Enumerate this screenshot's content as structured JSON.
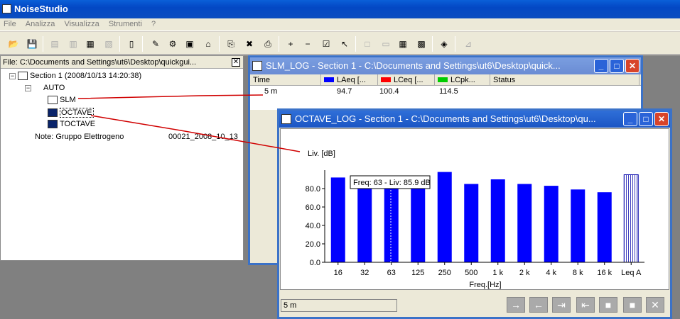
{
  "app": {
    "title": "NoiseStudio"
  },
  "menu": [
    "File",
    "Analizza",
    "Visualizza",
    "Strumenti",
    "?"
  ],
  "file_panel": {
    "title": "File: C:\\Documents and Settings\\ut6\\Desktop\\quickgui...",
    "section": "Section 1   (2008/10/13 14:20:38)",
    "auto": "AUTO",
    "slm": "SLM",
    "octave": "OCTAVE",
    "toctave": "TOCTAVE",
    "note": "Note: Gruppo Elettrogeno",
    "note_id": "00021_2008_10_13"
  },
  "slm_window": {
    "title": "SLM_LOG - Section 1 - C:\\Documents and Settings\\ut6\\Desktop\\quick...",
    "columns": [
      "Time",
      "LAeq [...",
      "LCeq [...",
      "LCpk...",
      "Status"
    ],
    "swatch_colors": [
      "#0000ff",
      "#ff0000",
      "#00cc00"
    ],
    "row": [
      "5 m",
      "94.7",
      "100.4",
      "114.5",
      ""
    ]
  },
  "octave_window": {
    "title": "OCTAVE_LOG - Section 1 - C:\\Documents and Settings\\ut6\\Desktop\\qu...",
    "tooltip": "Freq: 63 - Liv: 85.9 dB",
    "status": "5 m"
  },
  "chart_data": {
    "type": "bar",
    "ylabel": "Liv. [dB]",
    "xlabel": "Freq.[Hz]",
    "categories": [
      "16",
      "32",
      "63",
      "125",
      "250",
      "500",
      "1 k",
      "2 k",
      "4 k",
      "8 k",
      "16 k",
      "Leq A"
    ],
    "values": [
      92,
      89,
      85.9,
      83,
      98,
      85,
      90,
      85,
      83,
      79,
      76,
      95
    ],
    "yticks": [
      "0.0",
      "20.0",
      "40.0",
      "60.0",
      "80.0"
    ],
    "ylim": [
      0,
      100
    ],
    "bar_color": "#0000ff",
    "grid": false
  }
}
